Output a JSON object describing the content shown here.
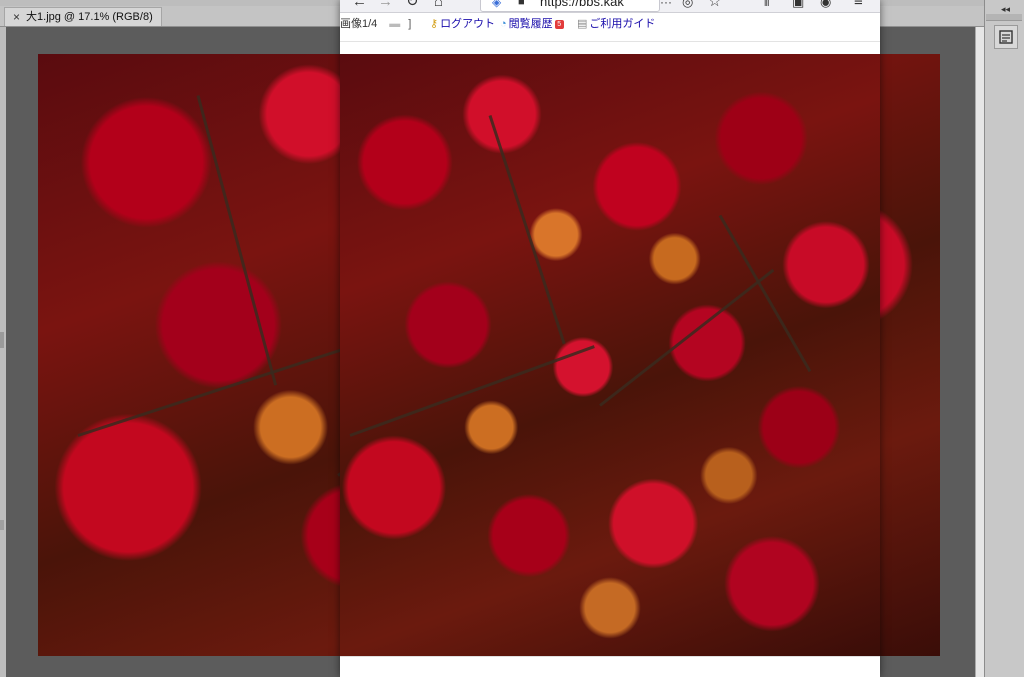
{
  "editor": {
    "doc_tab": {
      "close_glyph": "×",
      "title": "大1.jpg @ 17.1% (RGB/8)"
    },
    "panel": {
      "collapse_glyph": "◂◂",
      "icon": "properties-panel-icon"
    },
    "accent_colors": {
      "canvas_bg": "#5c5c5c",
      "chrome": "#c4c4c4"
    }
  },
  "browser": {
    "toolbar": {
      "url_text": "https://bbs.kak",
      "icons": [
        "back-icon",
        "forward-icon",
        "reload-icon",
        "home-icon",
        "shield-icon",
        "lock-icon",
        "more-icon",
        "pocket-icon",
        "bookmark-star-icon",
        "library-icon",
        "sidebar-icon",
        "account-icon",
        "menu-icon"
      ]
    },
    "site_links": {
      "counter": "画像1/4",
      "logout": "ログアウト",
      "history": "閲覧履歴",
      "history_badge": "5",
      "guide": "ご利用ガイド"
    }
  }
}
